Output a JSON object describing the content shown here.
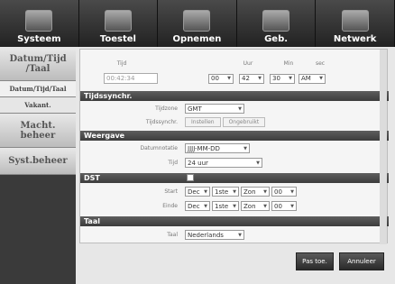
{
  "topbar": {
    "tabs": [
      {
        "label": "Systeem",
        "icon": "monitor-icon"
      },
      {
        "label": "Toestel",
        "icon": "camera-icon"
      },
      {
        "label": "Opnemen",
        "icon": "rec-icon"
      },
      {
        "label": "Geb.",
        "icon": "event-icon"
      },
      {
        "label": "Netwerk",
        "icon": "network-icon"
      }
    ]
  },
  "sidebar": {
    "items": [
      {
        "label": "Datum/Tijd\n/Taal"
      },
      {
        "label": "Datum/Tijd/Taal"
      },
      {
        "label": "Vakant."
      },
      {
        "label": "Macht.\nbeheer"
      },
      {
        "label": "Syst.beheer"
      }
    ]
  },
  "time": {
    "label": "Tijd",
    "hour_label": "Uur",
    "min_label": "Min",
    "sec_label": "sec",
    "current_value": "00:42:34",
    "hour": "00",
    "min": "42",
    "sec": "30",
    "ampm": "AM"
  },
  "sync": {
    "section": "Tijdssynchr.",
    "timezone_label": "Tijdzone",
    "timezone_value": "GMT",
    "sync_label": "Tijdssynchr.",
    "settings_label": "Instellen",
    "unused_label": "Ongebruikt"
  },
  "display": {
    "section": "Weergave",
    "dateformat_label": "Datumnotatie",
    "dateformat_value": "JJJJ-MM-DD",
    "time_label": "Tijd",
    "time_value": "24 uur"
  },
  "dst": {
    "section": "DST",
    "start_label": "Start",
    "end_label": "Einde",
    "start": {
      "month": "Dec",
      "week": "1ste",
      "day": "Zon",
      "hour": "00"
    },
    "end": {
      "month": "Dec",
      "week": "1ste",
      "day": "Zon",
      "hour": "00"
    }
  },
  "language": {
    "section": "Taal",
    "label": "Taal",
    "value": "Nederlands"
  },
  "buttons": {
    "apply": "Pas toe.",
    "cancel": "Annuleer"
  }
}
